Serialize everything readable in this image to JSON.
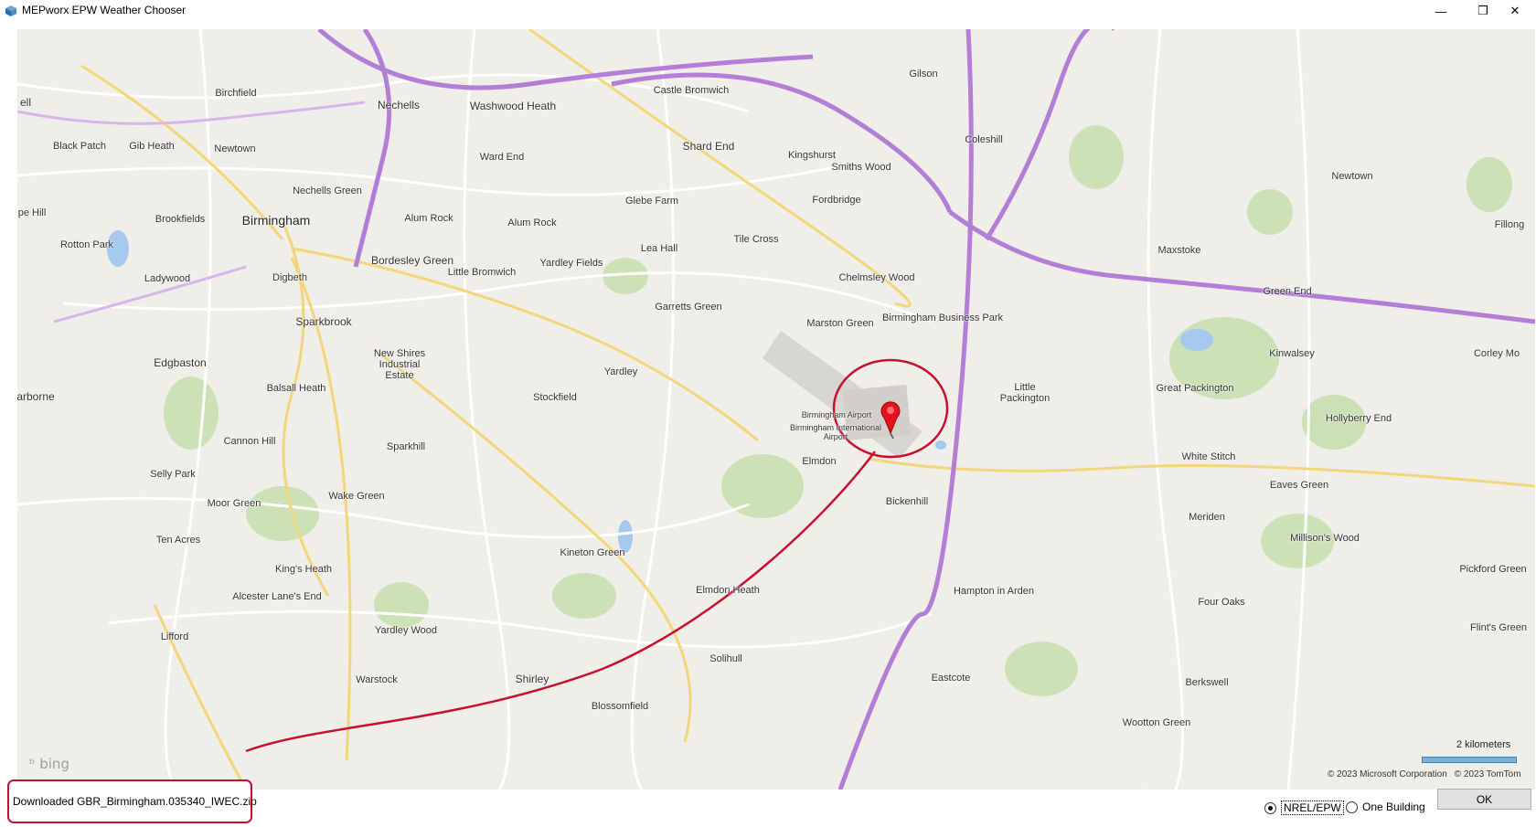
{
  "window": {
    "title": "MEPworx EPW Weather Chooser",
    "icon": "app-cube-icon",
    "controls": {
      "minimize": "—",
      "maximize": "❐",
      "close": "✕"
    }
  },
  "map": {
    "provider_logo": "bing",
    "places": {
      "nechells": "Nechells",
      "washwood_heath": "Washwood Heath",
      "birchfield": "Birchfield",
      "castle_bromwich": "Castle Bromwich",
      "black_patch": "Black Patch",
      "gib_heath": "Gib Heath",
      "newtown": "Newtown",
      "ward_end": "Ward End",
      "shard_end": "Shard End",
      "kingshurst": "Kingshurst",
      "smiths_wood": "Smiths Wood",
      "coleshill": "Coleshill",
      "gilson": "Gilson",
      "nechells_green": "Nechells Green",
      "glebe_farm": "Glebe Farm",
      "fordbridge": "Fordbridge",
      "brookfields": "Brookfields",
      "birmingham": "Birmingham",
      "alum_rock": "Alum Rock",
      "alum_rock_2": "Alum Rock",
      "newtown_east": "Newtown",
      "rotton_park": "Rotton Park",
      "tile_cross": "Tile Cross",
      "lea_hall": "Lea Hall",
      "maxstoke": "Maxstoke",
      "bordesley_green": "Bordesley Green",
      "little_bromwich": "Little Bromwich",
      "yardley_fields": "Yardley Fields",
      "ladywood": "Ladywood",
      "digbeth": "Digbeth",
      "chelmsley_wood": "Chelmsley Wood",
      "green_end": "Green End",
      "garretts_green": "Garretts Green",
      "birmingham_business_park": "Birmingham Business Park",
      "marston_green": "Marston Green",
      "sparkbrook": "Sparkbrook",
      "kinwalsey": "Kinwalsey",
      "corley_moor": "Corley Mo",
      "new_shires": "New Shires Industrial Estate",
      "edgbaston": "Edgbaston",
      "yardley": "Yardley",
      "great_packington": "Great Packington",
      "little_packington": "Little Packington",
      "balsall_heath": "Balsall Heath",
      "stockfield": "Stockfield",
      "harborne": "arborne",
      "birmingham_airport": "Birmingham Airport",
      "bhx_international": "Birmingham International Airport",
      "hollyberry_end": "Hollyberry End",
      "cannon_hill": "Cannon Hill",
      "sparkhill": "Sparkhill",
      "white_stitch": "White Stitch",
      "elmdon": "Elmdon",
      "selly_park": "Selly Park",
      "eaves_green": "Eaves Green",
      "wake_green": "Wake Green",
      "bickenhill": "Bickenhill",
      "moor_green": "Moor Green",
      "meriden": "Meriden",
      "ten_acres": "Ten Acres",
      "millisons_wood": "Millison's Wood",
      "kineton_green": "Kineton Green",
      "kings_heath": "King's Heath",
      "pickford_green": "Pickford Green",
      "hampton_in_arden": "Hampton in Arden",
      "elmdon_heath": "Elmdon Heath",
      "alcester_lanes_end": "Alcester Lane's End",
      "four_oaks": "Four Oaks",
      "yardley_wood": "Yardley Wood",
      "lifford": "Lifford",
      "flints_green": "Flint's Green",
      "solihull": "Solihull",
      "eastcote": "Eastcote",
      "shirley": "Shirley",
      "warstock": "Warstock",
      "berkswell": "Berkswell",
      "blossomfield": "Blossomfield",
      "wootton_green": "Wootton Green",
      "newtown_far": "Newtown",
      "fillongley": "Fillong",
      "ell": "ell",
      "pe_hill": "pe Hill"
    },
    "scale_label": "2 kilometers",
    "copyright_microsoft": "© 2023 Microsoft Corporation",
    "copyright_tomtom": "© 2023 TomTom"
  },
  "status": {
    "message": "Downloaded GBR_Birmingham.035340_IWEC.zip"
  },
  "source_options": [
    {
      "label": "NREL/EPW",
      "selected": true
    },
    {
      "label": "One Building",
      "selected": false
    }
  ],
  "ok_button": {
    "label": "OK"
  },
  "colors": {
    "highlight_red": "#c8102e",
    "motorway_purple": "#b27ed6",
    "map_background": "#f0eee9",
    "park_green": "#c9dfb1",
    "water_blue": "#a5c8ee"
  }
}
